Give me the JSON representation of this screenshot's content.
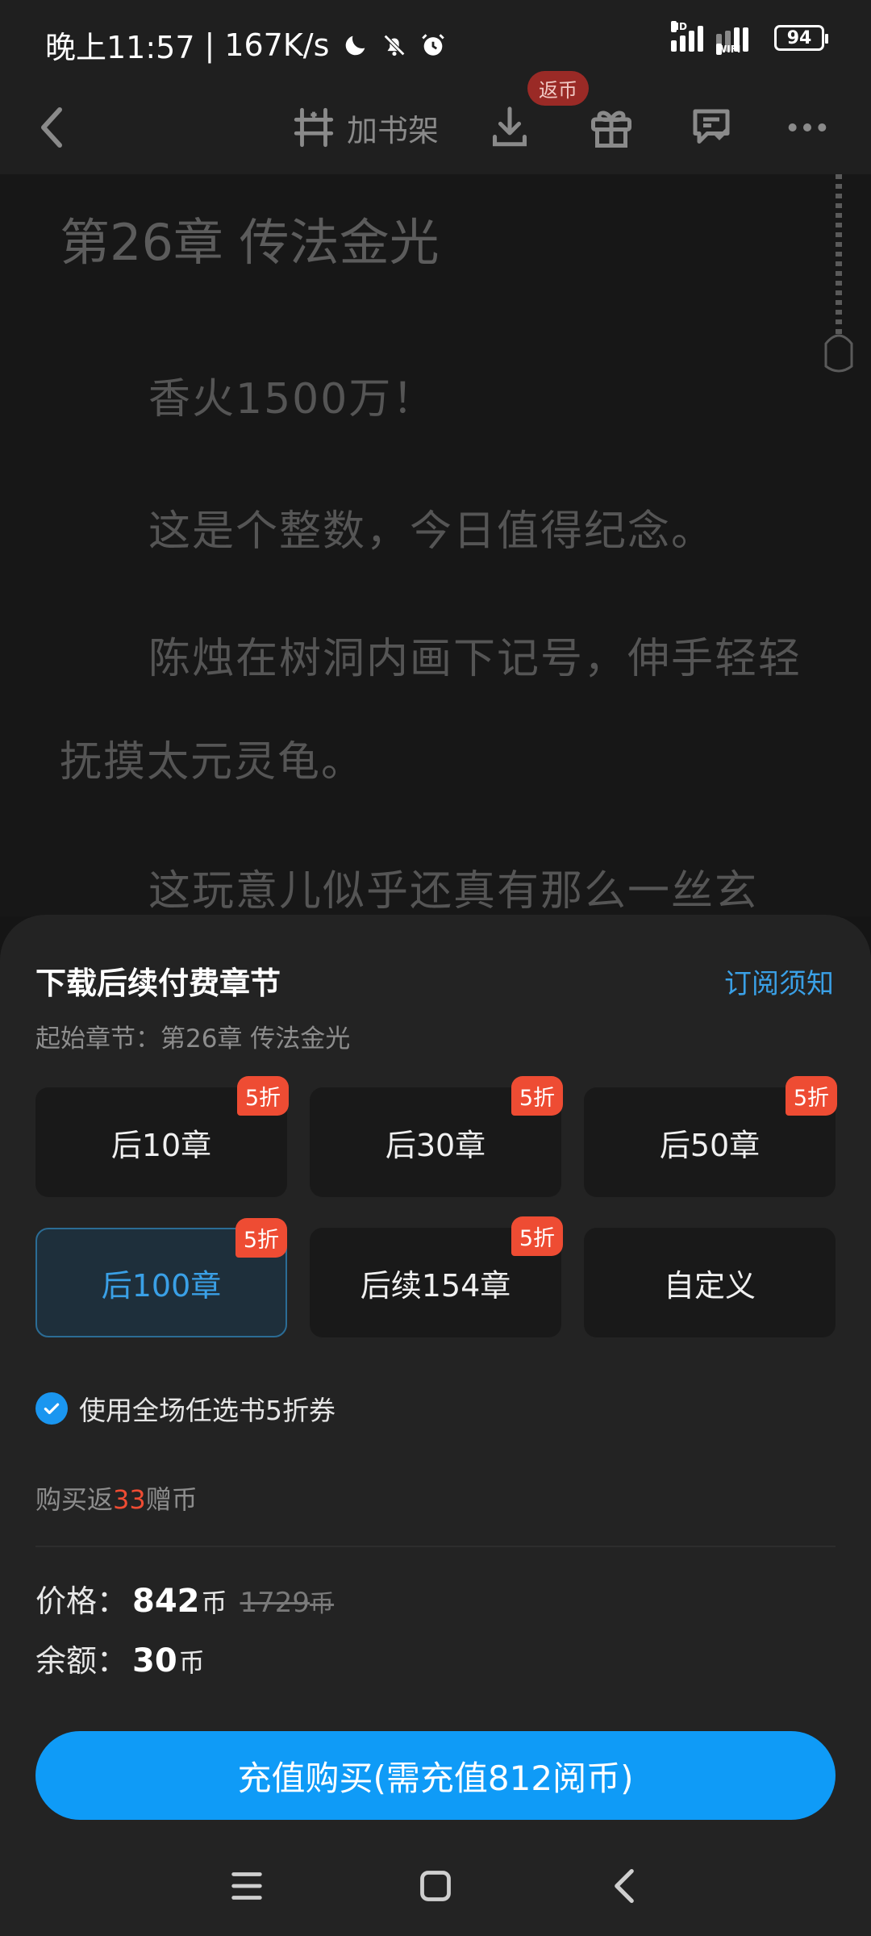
{
  "status_bar": {
    "time": "晚上11:57",
    "speed": "167K/s",
    "battery": "94",
    "hd": "HD",
    "wifi": "WIFI"
  },
  "toolbar": {
    "add_shelf_label": "加书架",
    "coin_badge": "返币"
  },
  "article": {
    "chapter_title": "第26章 传法金光",
    "paragraphs": [
      "香火1500万！",
      "这是个整数，今日值得纪念。",
      "陈烛在树洞内画下记号，伸手轻轻",
      "抚摸太元灵龟。",
      "这玩意儿似乎还真有那么一丝玄"
    ]
  },
  "sheet": {
    "title": "下载后续付费章节",
    "subscribe_notice": "订阅须知",
    "start_chapter": "起始章节：第26章 传法金光",
    "options": [
      {
        "label": "后10章",
        "badge": "5折"
      },
      {
        "label": "后30章",
        "badge": "5折"
      },
      {
        "label": "后50章",
        "badge": "5折"
      },
      {
        "label": "后100章",
        "badge": "5折",
        "selected": true
      },
      {
        "label": "后续154章",
        "badge": "5折"
      },
      {
        "label": "自定义"
      }
    ],
    "coupon_label": "使用全场任选书5折券",
    "rebate_prefix": "购买返",
    "rebate_num": "33",
    "rebate_suffix": "赠币",
    "price_label": "价格：",
    "price_value": "842",
    "price_unit": "币",
    "old_price_value": "1729",
    "old_price_unit": "币",
    "balance_label": "余额：",
    "balance_value": "30",
    "balance_unit": "币",
    "buy_button": "充值购买(需充值812阅币)"
  },
  "colors": {
    "accent": "#0f9bf7",
    "link": "#3aa0e6",
    "discount": "#ee4c33"
  }
}
